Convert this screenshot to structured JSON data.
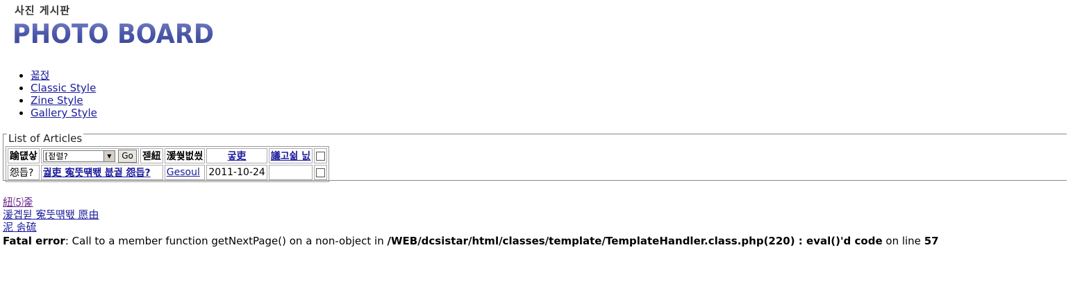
{
  "header": {
    "subtitle": "사진 게시판",
    "logo_text": "PHOTO BOARD",
    "logo_color": "#4b57a8"
  },
  "nav": {
    "items": [
      {
        "label": "꾧젅"
      },
      {
        "label": "Classic Style"
      },
      {
        "label": "Zine Style"
      },
      {
        "label": "Gallery Style"
      }
    ]
  },
  "articles": {
    "legend": "List of Articles",
    "header": {
      "col1": "踰덊샇",
      "select_value": "[젙렬?",
      "go_label": "Go",
      "col3": "젣紐",
      "col4": "湲쒖벖씠",
      "col5": "궇吏",
      "col6": "議고쉶 닔"
    },
    "rows": [
      {
        "num": "怨듭?",
        "title": "궗吏 寃뚯떆뙋 븞궡 怨듭?",
        "author": "Gesoul",
        "date": "2011-10-24",
        "views": ""
      }
    ]
  },
  "bottom_links": [
    {
      "label": "紐⑸줉"
    },
    {
      "label": "湲곕뒫 寃뚯떆뙋 愿由"
    },
    {
      "label": "泥 솕硫"
    }
  ],
  "error": {
    "label": "Fatal error",
    "message": ": Call to a member function getNextPage() on a non-object in ",
    "path": "/WEB/dcsistar/html/classes/template/TemplateHandler.class.php(220) : eval()'d code",
    "suffix": " on line ",
    "line": "57"
  }
}
